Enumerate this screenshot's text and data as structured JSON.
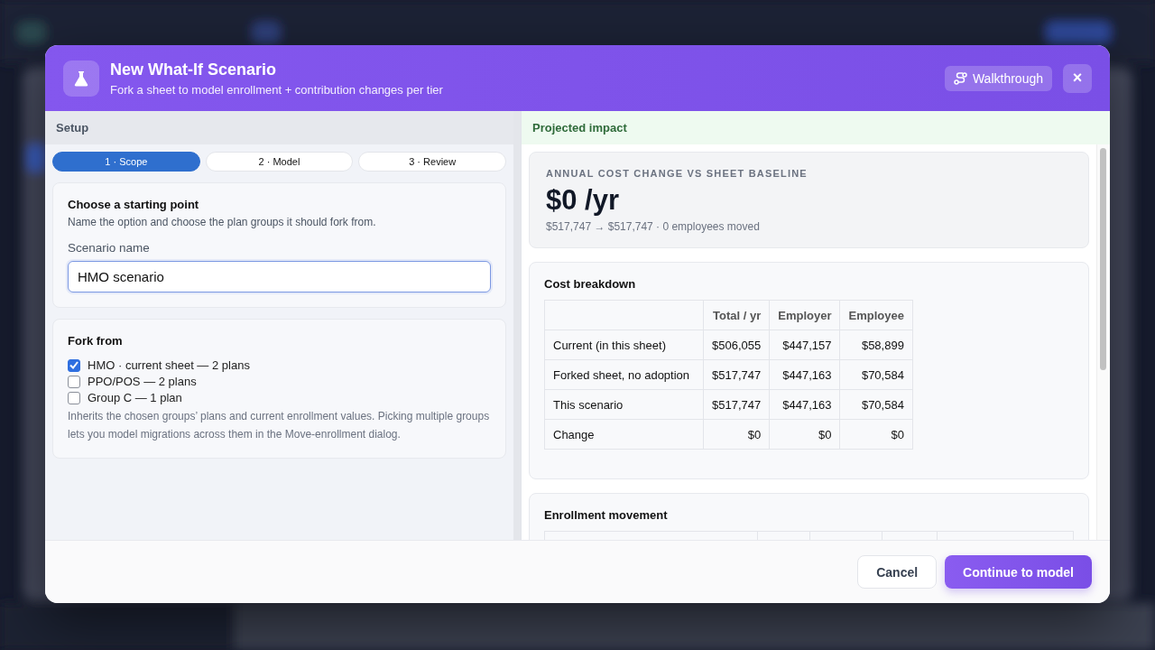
{
  "header": {
    "title": "New What-If Scenario",
    "subtitle": "Fork a sheet to model enrollment + contribution changes per tier",
    "walkthrough": "Walkthrough",
    "close": "×"
  },
  "setup": {
    "title": "Setup",
    "steps": [
      {
        "label": "1 · Scope",
        "selected": true
      },
      {
        "label": "2 · Model",
        "selected": false
      },
      {
        "label": "3 · Review",
        "selected": false
      }
    ],
    "starting_point": {
      "title": "Choose a starting point",
      "description": "Name the option and choose the plan groups it should fork from.",
      "field_label": "Scenario name",
      "value": "HMO scenario"
    },
    "fork_from": {
      "title": "Fork from",
      "options": [
        {
          "label": "HMO · current sheet — 2 plans",
          "checked": true
        },
        {
          "label": "PPO/POS — 2 plans",
          "checked": false
        },
        {
          "label": "Group C — 1 plan",
          "checked": false
        }
      ],
      "note": "Inherits the chosen groups’ plans and current enrollment values. Picking multiple groups lets you model migrations across them in the Move-enrollment dialog."
    }
  },
  "impact": {
    "title": "Projected impact",
    "summary": {
      "label": "ANNUAL COST CHANGE VS SHEET BASELINE",
      "value": "$0 /yr",
      "detail": "$517,747 → $517,747 · 0 employees moved"
    },
    "cost_breakdown": {
      "title": "Cost breakdown",
      "columns": [
        "Total / yr",
        "Employer",
        "Employee"
      ],
      "rows": [
        {
          "label": "Current (in this sheet)",
          "values": [
            "$506,055",
            "$447,157",
            "$58,899"
          ]
        },
        {
          "label": "Forked sheet, no adoption",
          "values": [
            "$517,747",
            "$447,163",
            "$70,584"
          ]
        },
        {
          "label": "This scenario",
          "values": [
            "$517,747",
            "$447,163",
            "$70,584"
          ]
        },
        {
          "label": "Change",
          "values": [
            "$0",
            "$0",
            "$0"
          ]
        }
      ]
    },
    "enrollment_movement": {
      "title": "Enrollment movement"
    }
  },
  "footer": {
    "buttons": [
      {
        "label": "Cancel",
        "kind": "secondary"
      },
      {
        "label": "Continue to model",
        "kind": "primary"
      }
    ]
  }
}
